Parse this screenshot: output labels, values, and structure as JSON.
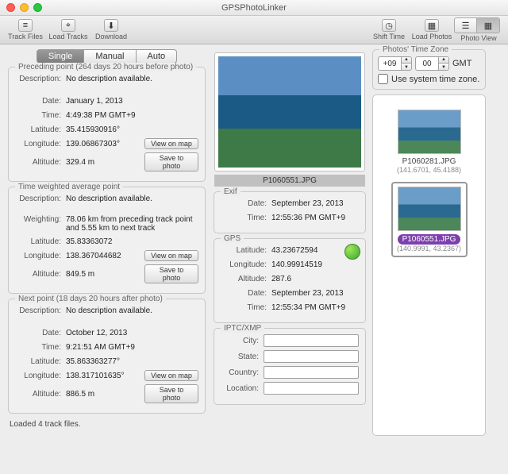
{
  "title": "GPSPhotoLinker",
  "toolbar": {
    "track_files": "Track Files",
    "load_tracks": "Load Tracks",
    "download": "Download",
    "shift_time": "Shift Time",
    "load_photos": "Load Photos",
    "photo_view": "Photo View"
  },
  "tabs": {
    "single": "Single",
    "manual": "Manual",
    "auto": "Auto"
  },
  "preceding": {
    "title": "Preceding point (264 days 20 hours before photo)",
    "desc_lbl": "Description:",
    "desc": "No description available.",
    "date_lbl": "Date:",
    "date": "January 1, 2013",
    "time_lbl": "Time:",
    "time": "4:49:38 PM GMT+9",
    "lat_lbl": "Latitude:",
    "lat": "35.415930916°",
    "lon_lbl": "Longitude:",
    "lon": "139.06867303°",
    "alt_lbl": "Altitude:",
    "alt": "329.4 m",
    "view": "View on map",
    "save": "Save to photo"
  },
  "weighted": {
    "title": "Time weighted average point",
    "desc_lbl": "Description:",
    "desc": "No description available.",
    "wt_lbl": "Weighting:",
    "wt": "78.06 km from preceding track point and 5.55 km to next track",
    "lat_lbl": "Latitude:",
    "lat": "35.83363072",
    "lon_lbl": "Longitude:",
    "lon": "138.367044682",
    "alt_lbl": "Altitude:",
    "alt": "849.5 m",
    "view": "View on map",
    "save": "Save to photo"
  },
  "next": {
    "title": "Next point (18 days 20 hours after photo)",
    "desc_lbl": "Description:",
    "desc": "No description available.",
    "date_lbl": "Date:",
    "date": "October 12, 2013",
    "time_lbl": "Time:",
    "time": "9:21:51 AM GMT+9",
    "lat_lbl": "Latitude:",
    "lat": "35.863363277°",
    "lon_lbl": "Longitude:",
    "lon": "138.317101635°",
    "alt_lbl": "Altitude:",
    "alt": "886.5 m",
    "view": "View on map",
    "save": "Save to photo"
  },
  "loaded": "Loaded 4 track files.",
  "photo_name": "P1060551.JPG",
  "exif": {
    "title": "Exif",
    "date_lbl": "Date:",
    "date": "September 23, 2013",
    "time_lbl": "Time:",
    "time": "12:55:36 PM GMT+9"
  },
  "gps": {
    "title": "GPS",
    "lat_lbl": "Latitude:",
    "lat": "43.23672594",
    "lon_lbl": "Longitude:",
    "lon": "140.99914519",
    "alt_lbl": "Altitude:",
    "alt": "287.6",
    "date_lbl": "Date:",
    "date": "September 23, 2013",
    "time_lbl": "Time:",
    "time": "12:55:34 PM GMT+9"
  },
  "iptc": {
    "title": "IPTC/XMP",
    "city": "City:",
    "state": "State:",
    "country": "Country:",
    "location": "Location:"
  },
  "tz": {
    "title": "Photos' Time Zone",
    "hours": "+09",
    "mins": "00",
    "gmt": "GMT",
    "use_sys": "Use system time zone."
  },
  "thumbs": [
    {
      "name": "P1060281.JPG",
      "coord": "(141.6701, 45.4188)",
      "selected": false
    },
    {
      "name": "P1060551.JPG",
      "coord": "(140.9991, 43.2367)",
      "selected": true
    }
  ]
}
